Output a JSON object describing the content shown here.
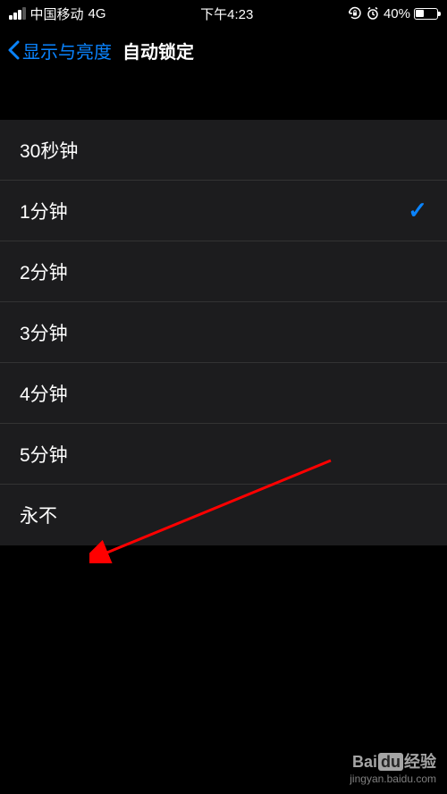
{
  "statusBar": {
    "carrier": "中国移动",
    "network": "4G",
    "time": "下午4:23",
    "batteryPercent": "40%"
  },
  "nav": {
    "backLabel": "显示与亮度",
    "title": "自动锁定"
  },
  "options": [
    {
      "label": "30秒钟",
      "selected": false
    },
    {
      "label": "1分钟",
      "selected": true
    },
    {
      "label": "2分钟",
      "selected": false
    },
    {
      "label": "3分钟",
      "selected": false
    },
    {
      "label": "4分钟",
      "selected": false
    },
    {
      "label": "5分钟",
      "selected": false
    },
    {
      "label": "永不",
      "selected": false
    }
  ],
  "watermark": {
    "brand1": "Bai",
    "brand2": "du",
    "brand3": "经验",
    "url": "jingyan.baidu.com"
  }
}
